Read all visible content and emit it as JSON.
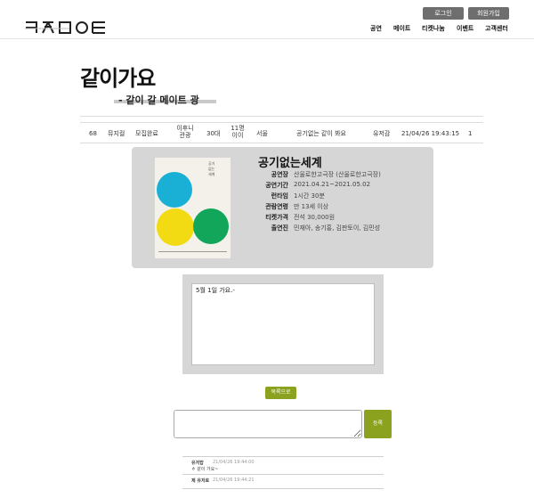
{
  "header": {
    "logo": "ㅋㅊㅁㅇㅌ",
    "login": "로그인",
    "signup": "회원가입",
    "nav": [
      "공연",
      "메이트",
      "티켓나눔",
      "이벤트",
      "고객센터"
    ]
  },
  "page": {
    "title": "같이가요",
    "subtitle": "- 같이 갈 메이트 광"
  },
  "post_row": {
    "no": "68",
    "genre": "뮤지컬",
    "status": "모집완료",
    "meet": "이후니 관광",
    "age": "30대",
    "gender": "11명 이이",
    "region": "서울",
    "subject": "공기없는 같이 봐요",
    "author": "유저감",
    "date": "21/04/26 19:43:15",
    "views": "1"
  },
  "show": {
    "title": "공기없는세계",
    "poster_title": "공기\n없는\n세계",
    "fields": [
      {
        "k": "공연장",
        "v": "산울로한고극장 (산울로한고극장)"
      },
      {
        "k": "공연기간",
        "v": "2021.04.21~2021.05.02"
      },
      {
        "k": "런타임",
        "v": "1시간 30분"
      },
      {
        "k": "관람연령",
        "v": "만 13세 이상"
      },
      {
        "k": "티켓가격",
        "v": "전석 30,000원"
      },
      {
        "k": "출연진",
        "v": "민재아, 송기홍, 김판토이, 김민성"
      }
    ],
    "colors": {
      "blue": "#1ab0d6",
      "yellow": "#f2db12",
      "green": "#12a65a"
    }
  },
  "message": {
    "text": "5월 1일 가요.-"
  },
  "buttons": {
    "list": "목록으로",
    "submit": "등록"
  },
  "comments": [
    {
      "author": "유저탑",
      "time": "21/04/26 19:44:00",
      "body": "ㅎ 같이 가요~"
    },
    {
      "author": "제 유저로",
      "time": "21/04/26 19:44:21",
      "body": ""
    }
  ],
  "colors": {
    "accent": "#8aa21e",
    "header_button": "#6e6e6e",
    "card_bg": "#d6d6d6"
  }
}
